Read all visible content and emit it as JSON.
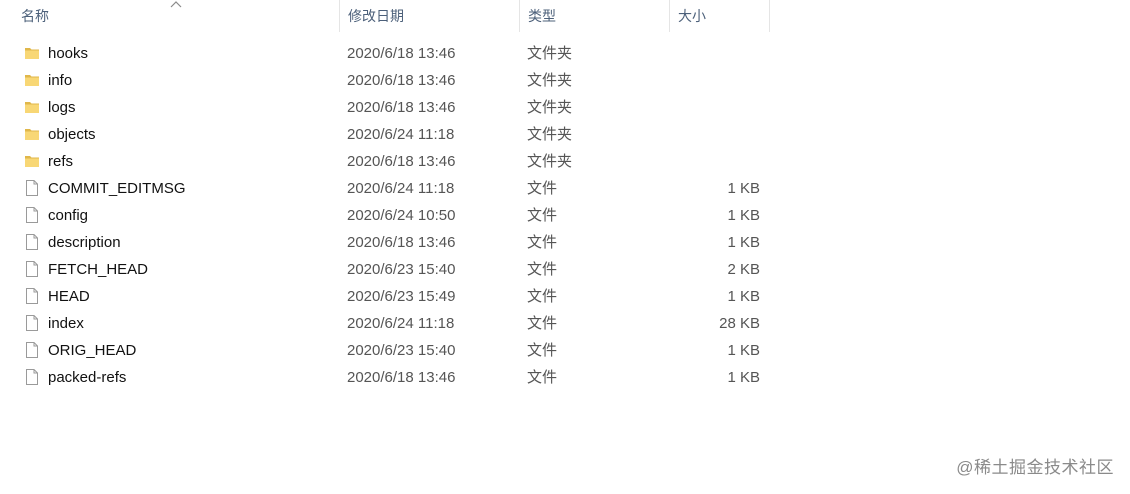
{
  "columns": {
    "name": "名称",
    "date": "修改日期",
    "type": "类型",
    "size": "大小"
  },
  "sort": {
    "column": "name",
    "direction": "ascending",
    "icon": "chevron-up-icon"
  },
  "files": [
    {
      "name": "hooks",
      "date": "2020/6/18 13:46",
      "type": "文件夹",
      "size": "",
      "icon": "folder-icon"
    },
    {
      "name": "info",
      "date": "2020/6/18 13:46",
      "type": "文件夹",
      "size": "",
      "icon": "folder-icon"
    },
    {
      "name": "logs",
      "date": "2020/6/18 13:46",
      "type": "文件夹",
      "size": "",
      "icon": "folder-icon"
    },
    {
      "name": "objects",
      "date": "2020/6/24 11:18",
      "type": "文件夹",
      "size": "",
      "icon": "folder-icon"
    },
    {
      "name": "refs",
      "date": "2020/6/18 13:46",
      "type": "文件夹",
      "size": "",
      "icon": "folder-icon"
    },
    {
      "name": "COMMIT_EDITMSG",
      "date": "2020/6/24 11:18",
      "type": "文件",
      "size": "1 KB",
      "icon": "file-icon"
    },
    {
      "name": "config",
      "date": "2020/6/24 10:50",
      "type": "文件",
      "size": "1 KB",
      "icon": "file-icon"
    },
    {
      "name": "description",
      "date": "2020/6/18 13:46",
      "type": "文件",
      "size": "1 KB",
      "icon": "file-icon"
    },
    {
      "name": "FETCH_HEAD",
      "date": "2020/6/23 15:40",
      "type": "文件",
      "size": "2 KB",
      "icon": "file-icon"
    },
    {
      "name": "HEAD",
      "date": "2020/6/23 15:49",
      "type": "文件",
      "size": "1 KB",
      "icon": "file-icon"
    },
    {
      "name": "index",
      "date": "2020/6/24 11:18",
      "type": "文件",
      "size": "28 KB",
      "icon": "file-icon"
    },
    {
      "name": "ORIG_HEAD",
      "date": "2020/6/23 15:40",
      "type": "文件",
      "size": "1 KB",
      "icon": "file-icon"
    },
    {
      "name": "packed-refs",
      "date": "2020/6/18 13:46",
      "type": "文件",
      "size": "1 KB",
      "icon": "file-icon"
    }
  ],
  "watermark": "@稀土掘金技术社区",
  "colors": {
    "header_text": "#4c607a",
    "folder": "#f8d775",
    "folder_dark": "#e0b74a",
    "file_border": "#9a9a9a"
  }
}
